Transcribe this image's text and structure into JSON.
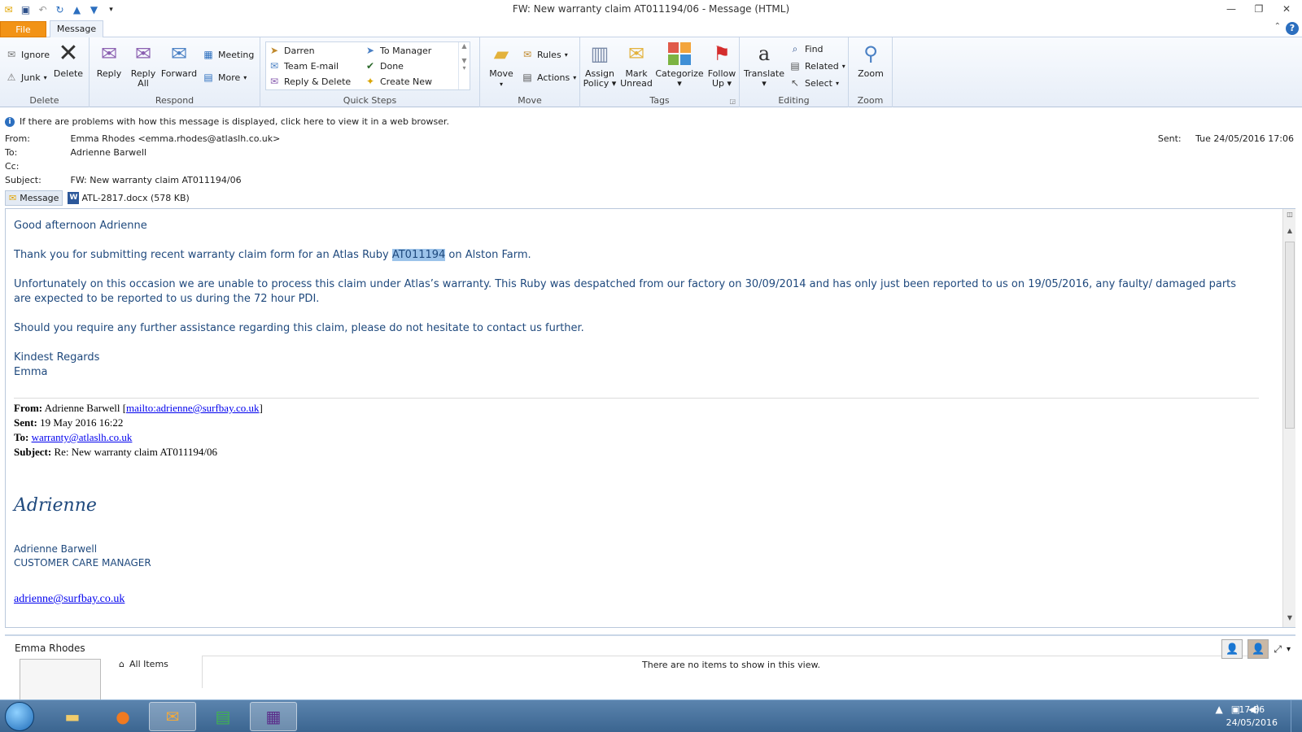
{
  "window": {
    "title": "FW: New warranty claim AT011194/06  -  Message (HTML)"
  },
  "tabs": {
    "file": "File",
    "message": "Message"
  },
  "ribbon": {
    "delete_group": {
      "label": "Delete",
      "ignore": "Ignore",
      "junk": "Junk",
      "delete": "Delete"
    },
    "respond_group": {
      "label": "Respond",
      "reply": "Reply",
      "reply_all_1": "Reply",
      "reply_all_2": "All",
      "forward": "Forward",
      "meeting": "Meeting",
      "more": "More"
    },
    "quick_steps": {
      "label": "Quick Steps",
      "items": [
        "Darren",
        "Team E-mail",
        "Reply & Delete",
        "To Manager",
        "Done",
        "Create New"
      ]
    },
    "move_group": {
      "label": "Move",
      "move": "Move",
      "rules": "Rules",
      "actions": "Actions"
    },
    "tags_group": {
      "label": "Tags",
      "assign_1": "Assign",
      "assign_2": "Policy",
      "mark_1": "Mark",
      "mark_2": "Unread",
      "categorize": "Categorize",
      "follow_1": "Follow",
      "follow_2": "Up"
    },
    "editing_group": {
      "label": "Editing",
      "translate": "Translate",
      "find": "Find",
      "related": "Related",
      "select": "Select"
    },
    "zoom_group": {
      "label": "Zoom",
      "zoom": "Zoom"
    }
  },
  "header": {
    "info": "If there are problems with how this message is displayed, click here to view it in a web browser.",
    "from_label": "From:",
    "from": "Emma Rhodes <emma.rhodes@atlaslh.co.uk>",
    "to_label": "To:",
    "to": "Adrienne Barwell",
    "cc_label": "Cc:",
    "subject_label": "Subject:",
    "subject": "FW: New warranty claim AT011194/06",
    "sent_label": "Sent:",
    "sent": "Tue 24/05/2016 17:06",
    "message_tab": "Message",
    "attachment": "ATL-2817.docx (578 KB)"
  },
  "body": {
    "greeting": "Good afternoon Adrienne",
    "p1_pre": "Thank you for submitting recent warranty claim form for an Atlas Ruby ",
    "p1_hl": "AT011194",
    "p1_post": " on Alston Farm.",
    "p2": "Unfortunately on this occasion we are unable to process this claim under Atlas’s warranty. This Ruby was despatched from our factory on 30/09/2014 and has only just been reported to us on 19/05/2016, any faulty/ damaged parts are expected to be reported to us during the 72 hour PDI.",
    "p3": "Should you require any further assistance regarding this claim, please do not hesitate to contact us further.",
    "closing": "Kindest Regards",
    "name": "Emma",
    "fwd": {
      "from_label": "From:",
      "from_name": " Adrienne Barwell [",
      "from_link": "mailto:adrienne@surfbay.co.uk",
      "from_end": "]",
      "sent_label": "Sent:",
      "sent": " 19 May 2016 16:22",
      "to_label": "To:",
      "to_link": "warranty@atlaslh.co.uk",
      "subject_label": "Subject:",
      "subject": " Re: New warranty claim AT011194/06"
    },
    "script_sig": "Adrienne",
    "sig_name": "Adrienne Barwell",
    "sig_title": "CUSTOMER CARE MANAGER",
    "sig_email": "adrienne@surfbay.co.uk"
  },
  "people_pane": {
    "name": "Emma Rhodes",
    "all_items": "All Items",
    "empty": "There are no items to show in this view."
  },
  "taskbar": {
    "time": "17:36",
    "date": "24/05/2016"
  },
  "colors": {
    "file_tab": "#f29316",
    "body_text": "#1f497d",
    "highlight": "#9cc3ea"
  }
}
